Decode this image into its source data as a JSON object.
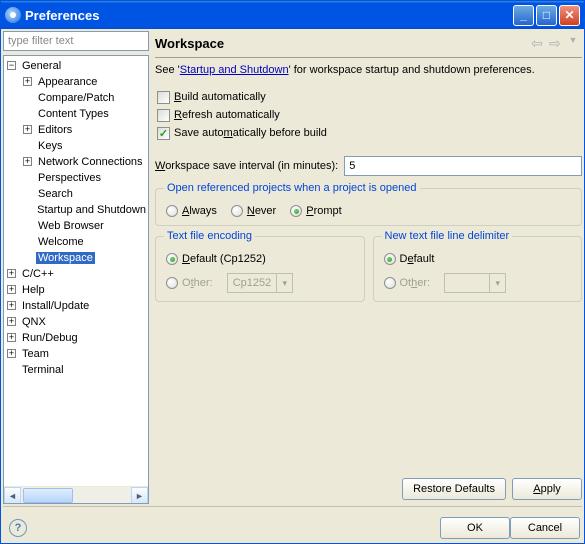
{
  "window": {
    "title": "Preferences"
  },
  "filter": {
    "placeholder": "type filter text"
  },
  "tree": {
    "nodes": [
      "General",
      "Appearance",
      "Compare/Patch",
      "Content Types",
      "Editors",
      "Keys",
      "Network Connections",
      "Perspectives",
      "Search",
      "Startup and Shutdown",
      "Web Browser",
      "Welcome",
      "Workspace",
      "C/C++",
      "Help",
      "Install/Update",
      "QNX",
      "Run/Debug",
      "Team",
      "Terminal"
    ]
  },
  "page": {
    "title": "Workspace",
    "descPrefix": "See '",
    "descLink": "Startup and Shutdown",
    "descSuffix": "' for workspace startup and shutdown preferences.",
    "buildAuto": "Build automatically",
    "refreshAuto": "Refresh automatically",
    "saveAuto": "Save automatically before build",
    "intervalLabel": "Workspace save interval (in minutes):",
    "intervalValue": "5",
    "openRef": {
      "legend": "Open referenced projects when a project is opened",
      "always": "Always",
      "never": "Never",
      "prompt": "Prompt"
    },
    "encoding": {
      "legend": "Text file encoding",
      "default": "Default (Cp1252)",
      "other": "Other:",
      "otherValue": "Cp1252"
    },
    "delimiter": {
      "legend": "New text file line delimiter",
      "default": "Default",
      "other": "Other:",
      "otherValue": ""
    },
    "restore": "Restore Defaults",
    "apply": "Apply"
  },
  "footer": {
    "ok": "OK",
    "cancel": "Cancel"
  }
}
